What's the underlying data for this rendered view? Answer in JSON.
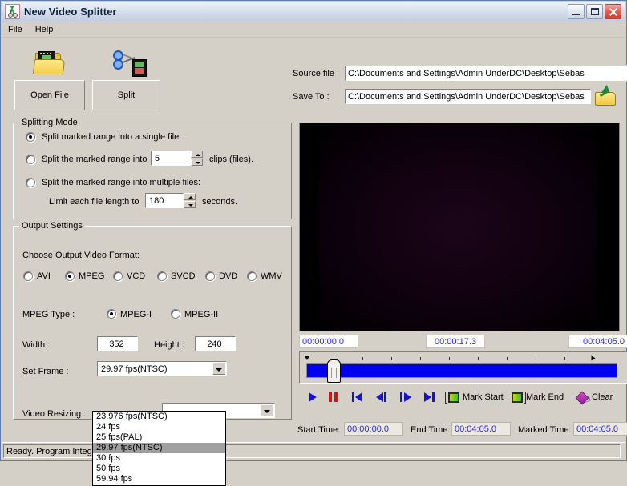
{
  "window": {
    "title": "New Video Splitter",
    "icon": "scissors-film-icon",
    "minimize": "Minimize",
    "maximize": "Maximize",
    "close": "Close"
  },
  "menu": {
    "items": [
      {
        "label": "File"
      },
      {
        "label": "Help"
      }
    ]
  },
  "toolbar": {
    "open_file_label": "Open File",
    "split_label": "Split"
  },
  "file_paths": {
    "source_label": "Source file :",
    "source_value": "C:\\Documents and Settings\\Admin UnderDC\\Desktop\\Sebas",
    "saveto_label": "Save To :",
    "saveto_value": "C:\\Documents and Settings\\Admin UnderDC\\Desktop\\Sebas",
    "browse_icon": "open-folder-icon"
  },
  "splitting_mode": {
    "title": "Splitting Mode",
    "option_single": "Split marked range into a single file.",
    "option_clips_prefix": "Split the marked range into",
    "option_clips_suffix": "clips (files).",
    "clips_value": "5",
    "option_multiple": "Split the marked range into multiple files:",
    "limit_prefix": "Limit each file length to",
    "limit_suffix": "seconds.",
    "limit_value": "180",
    "selected": "single"
  },
  "output_settings": {
    "title": "Output Settings",
    "format_label": "Choose Output Video Format:",
    "formats": [
      {
        "label": "AVI",
        "selected": false
      },
      {
        "label": "MPEG",
        "selected": true
      },
      {
        "label": "VCD",
        "selected": false
      },
      {
        "label": "SVCD",
        "selected": false
      },
      {
        "label": "DVD",
        "selected": false
      },
      {
        "label": "WMV",
        "selected": false
      }
    ],
    "mpeg_type_label": "MPEG Type    :",
    "mpeg_types": [
      {
        "label": "MPEG-I",
        "selected": true
      },
      {
        "label": "MPEG-II",
        "selected": false
      }
    ],
    "width_label": "Width :",
    "width_value": "352",
    "height_label": "Height :",
    "height_value": "240",
    "set_frame_label": "Set Frame   :",
    "set_frame_value": "29.97 fps(NTSC)",
    "video_resizing_label": "Video Resizing :",
    "video_resizing_value": ""
  },
  "frame_dropdown": {
    "open": true,
    "options": [
      {
        "label": "23.976 fps(NTSC)",
        "selected": false
      },
      {
        "label": "24 fps",
        "selected": false
      },
      {
        "label": "25 fps(PAL)",
        "selected": false
      },
      {
        "label": "29.97 fps(NTSC)",
        "selected": true
      },
      {
        "label": "30 fps",
        "selected": false
      },
      {
        "label": "50 fps",
        "selected": false
      },
      {
        "label": "59.94 fps",
        "selected": false
      }
    ]
  },
  "player": {
    "time_start": "00:00:00.0",
    "time_current": "00:00:17.3",
    "time_total": "00:04:05.0",
    "transport": [
      {
        "name": "play",
        "label": "Play"
      },
      {
        "name": "pause",
        "label": "Pause"
      },
      {
        "name": "rewind-start",
        "label": "Go to start"
      },
      {
        "name": "step-back",
        "label": "Step backward"
      },
      {
        "name": "step-forward",
        "label": "Step forward"
      },
      {
        "name": "forward-end",
        "label": "Go to end"
      }
    ],
    "mark_start_label": "Mark Start",
    "mark_end_label": "Mark End",
    "clear_label": "Clear",
    "start_time_label": "Start Time:",
    "start_time_value": "00:00:00.0",
    "end_time_label": "End Time:",
    "end_time_value": "00:04:05.0",
    "marked_time_label": "Marked Time:",
    "marked_time_value": "00:04:05.0"
  },
  "statusbar": {
    "text": "Ready. Program Integrity Check UK."
  },
  "colors": {
    "window_face": "#d4d0c8",
    "timeline_fill": "#0000ee",
    "time_text": "#2b2be0",
    "play_icon": "#1414d2",
    "pause_icon": "#d01414",
    "close_button": "#cf3b30"
  }
}
